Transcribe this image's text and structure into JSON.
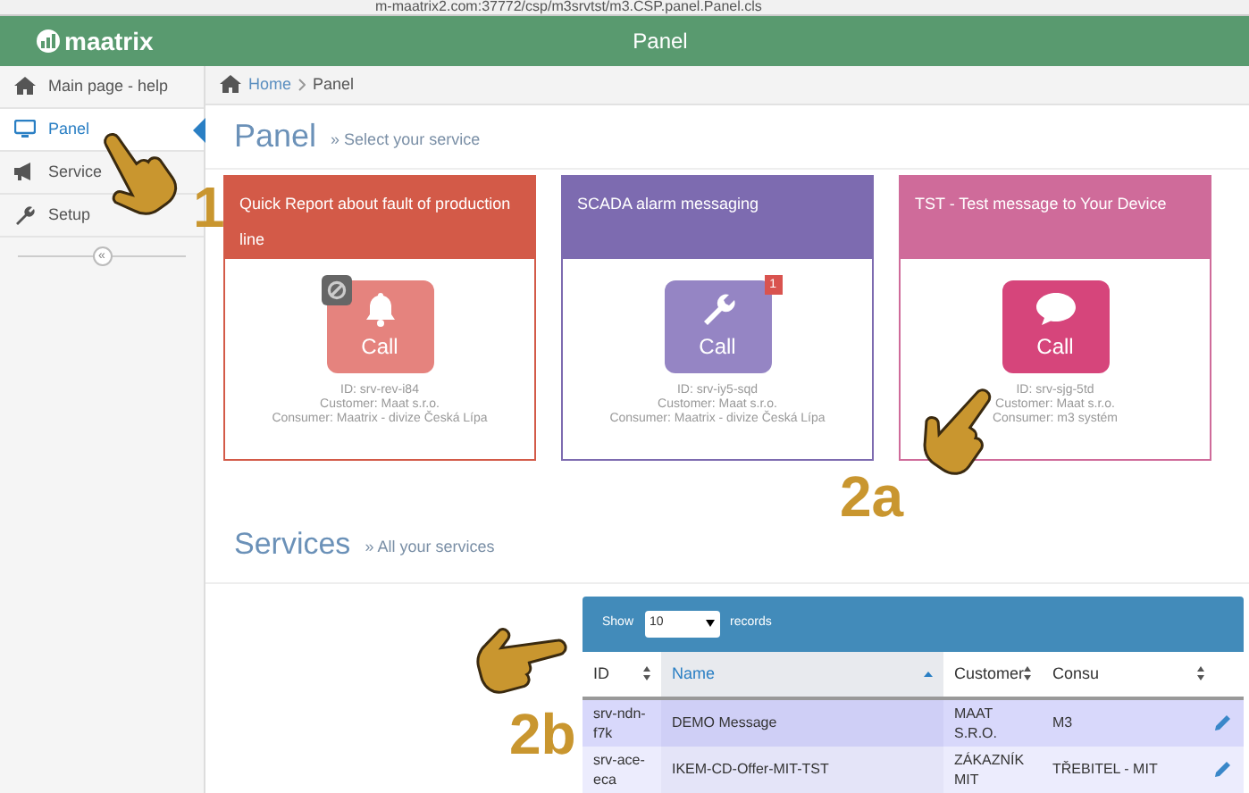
{
  "browser": {
    "url": "m-maatrix2.com:37772/csp/m3srvtst/m3.CSP.panel.Panel.cls"
  },
  "header": {
    "logo": "maatrix",
    "title": "Panel"
  },
  "sidebar": {
    "items": [
      {
        "label": "Main page - help",
        "selected": false
      },
      {
        "label": "Panel",
        "selected": true
      },
      {
        "label": "Service",
        "selected": false
      },
      {
        "label": "Setup",
        "selected": false
      }
    ],
    "collapse": "«"
  },
  "breadcrumb": [
    "Home",
    "Panel"
  ],
  "panel": {
    "title": "Panel",
    "subtitle": "» Select your service"
  },
  "cards": [
    {
      "title": "Quick Report about fault of production line",
      "color": "#d35a48",
      "blocked": true,
      "button": "Call",
      "id": "ID: srv-rev-i84",
      "customer": "Customer: Maat s.r.o.",
      "consumer": "Consumer: Maatrix - divize Česká Lípa"
    },
    {
      "title": "SCADA alarm messaging",
      "color": "#7d6bb0",
      "blocked": false,
      "badge": "1",
      "button": "Call",
      "id": "ID: srv-iy5-sqd",
      "customer": "Customer: Maat s.r.o.",
      "consumer": "Consumer: Maatrix - divize Česká Lípa"
    },
    {
      "title": "TST - Test message to Your Device",
      "color": "#cf6b9a",
      "blocked": false,
      "button": "Call",
      "id": "ID: srv-sjg-5td",
      "customer": "Customer: Maat s.r.o.",
      "consumer": "Consumer: m3 systém"
    }
  ],
  "services": {
    "title": "Services",
    "subtitle": "» All your services",
    "table": {
      "show_label": "Show",
      "page_size": "10",
      "records_label": "records",
      "columns": [
        {
          "label": "ID",
          "sorted": false
        },
        {
          "label": "Name",
          "sorted": true
        },
        {
          "label": "Customer",
          "sorted": false
        },
        {
          "label": "Consu",
          "sorted": false
        }
      ],
      "rows": [
        {
          "id": "srv-ndn-f7k",
          "name": "DEMO Message",
          "customer": "MAAT S.R.O.",
          "consumer": "M3",
          "selected": true
        },
        {
          "id": "srv-ace-eca",
          "name": "IKEM-CD-Offer-MIT-TST",
          "customer": "ZÁKAZNÍK MIT",
          "consumer": "TŘEBITEL - MIT",
          "selected": false
        }
      ]
    }
  },
  "annotations": [
    {
      "label": "1"
    },
    {
      "label": "2a"
    },
    {
      "label": "2b"
    }
  ]
}
